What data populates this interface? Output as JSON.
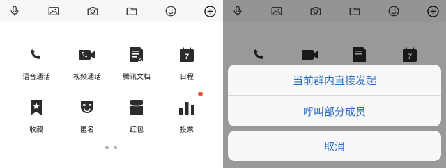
{
  "colors": {
    "icon": "#3a3a3a",
    "accent": "#2f6fc6",
    "badge": "#e8533a",
    "overlay": "rgba(0,0,0,0.40)"
  },
  "toolbar": {
    "icons": [
      "microphone-icon",
      "image-icon",
      "camera-icon",
      "folder-icon",
      "emoji-icon",
      "plus-circle-icon"
    ]
  },
  "panel": {
    "tiles": [
      {
        "icon": "phone-icon",
        "label": "语音通话"
      },
      {
        "icon": "video-camera-icon",
        "label": "视频通话"
      },
      {
        "icon": "document-icon",
        "label": "腾讯文档"
      },
      {
        "icon": "calendar-icon",
        "label": "日程",
        "calendar_day": "7"
      },
      {
        "icon": "bookmark-star-icon",
        "label": "收藏"
      },
      {
        "icon": "mask-icon",
        "label": "匿名"
      },
      {
        "icon": "red-packet-icon",
        "label": "红包"
      },
      {
        "icon": "poll-bars-icon",
        "label": "投票",
        "badge": true
      }
    ],
    "page_indicator": {
      "current": 1,
      "total": 2
    }
  },
  "action_sheet": {
    "options": [
      "当前群内直接发起",
      "呼叫部分成员"
    ],
    "cancel_label": "取消"
  }
}
